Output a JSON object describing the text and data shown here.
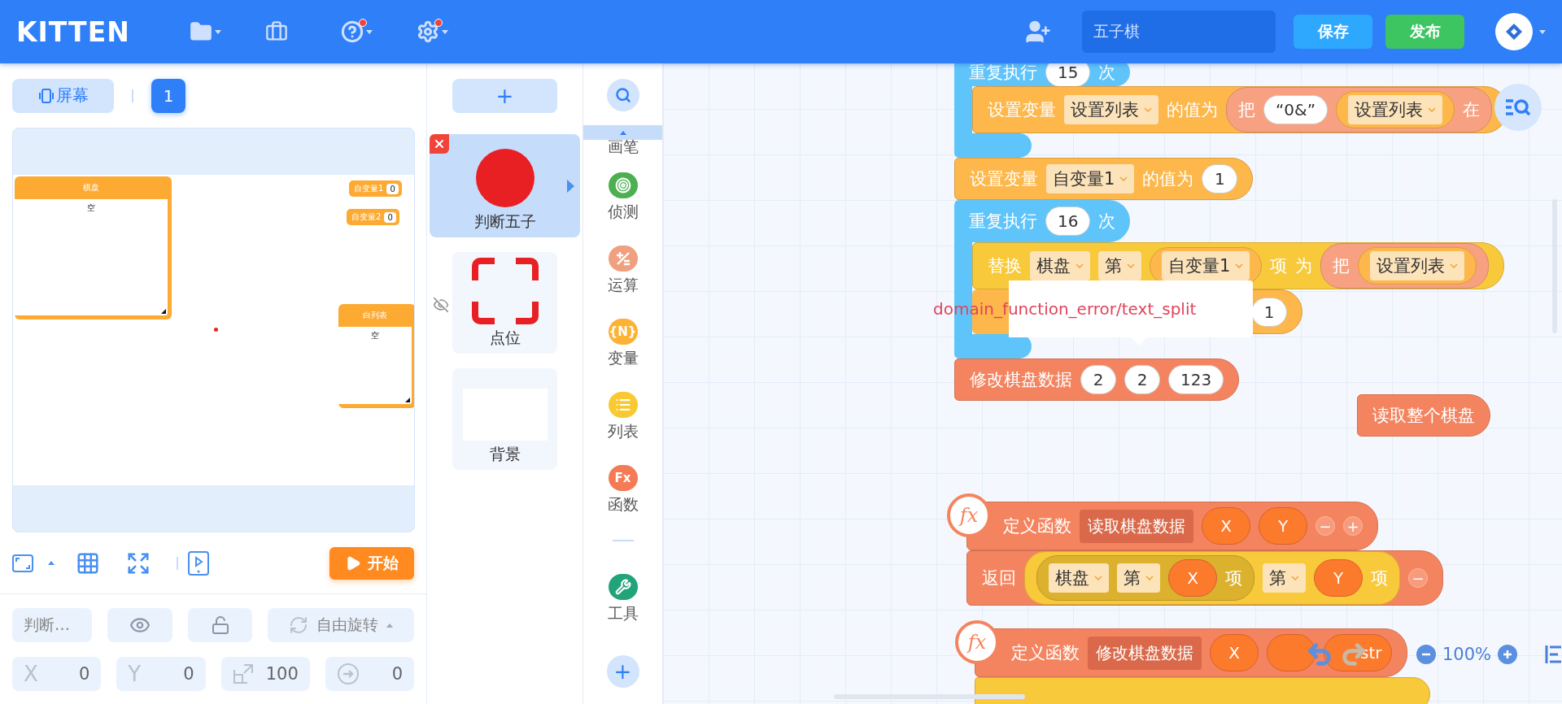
{
  "header": {
    "logo": "KITTEN",
    "menus": [
      {
        "kind": "file",
        "badge": false
      },
      {
        "kind": "bag",
        "badge": false
      },
      {
        "kind": "help",
        "badge": true
      },
      {
        "kind": "settings",
        "badge": true
      }
    ],
    "project_name": "五子棋",
    "save": "保存",
    "publish": "发布"
  },
  "stage_panel": {
    "screen_button": "屏幕",
    "screens": [
      {
        "label": "1",
        "selected": true
      }
    ],
    "monitors": [
      {
        "kind": "list",
        "title": "棋盘",
        "content": "空"
      },
      {
        "kind": "variable",
        "title": "自变量1",
        "value": "0"
      },
      {
        "kind": "variable",
        "title": "自变量2",
        "value": "0"
      },
      {
        "kind": "list",
        "title": "白列表",
        "content": "空"
      }
    ],
    "start": "开始",
    "sprite_props": {
      "name": "判断…",
      "rotation": "自由旋转",
      "fields": [
        {
          "kind": "x",
          "label": "X",
          "value": "0"
        },
        {
          "kind": "y",
          "label": "Y",
          "value": "0"
        },
        {
          "kind": "size",
          "value": "100"
        },
        {
          "kind": "direction",
          "value": "0"
        }
      ]
    }
  },
  "sprites": {
    "add": "+",
    "items": [
      {
        "name": "判断五子",
        "kind": "circle",
        "selected": true,
        "hidden": false
      },
      {
        "name": "点位",
        "kind": "corners",
        "selected": false,
        "hidden": true
      },
      {
        "name": "背景",
        "kind": "blank",
        "selected": false,
        "hidden": false
      }
    ]
  },
  "categories": {
    "items": [
      {
        "kind": "pen",
        "label": "画笔"
      },
      {
        "kind": "sensing",
        "label": "侦测",
        "color": "#4caf50"
      },
      {
        "kind": "operator",
        "label": "运算",
        "color": "#f0a07f"
      },
      {
        "kind": "variable",
        "label": "变量",
        "glyph": "{N}",
        "color": "#fdb235"
      },
      {
        "kind": "list",
        "label": "列表",
        "color": "#f9c932"
      },
      {
        "kind": "function",
        "label": "函数",
        "glyph": "Fx",
        "color": "#f47b55"
      },
      {
        "kind": "tool",
        "label": "工具",
        "color": "#22a37a"
      }
    ],
    "add": "+"
  },
  "canvas": {
    "scripts": [
      {
        "blocks": [
          {
            "kind": "loop",
            "color": "#5fc4fa",
            "parts": [
              {
                "kind": "label",
                "text": "重复执行"
              },
              {
                "kind": "input",
                "text": "15"
              },
              {
                "kind": "label",
                "text": "次"
              }
            ],
            "body": [
              {
                "kind": "command",
                "color": "#fdb74a",
                "parts": [
                  {
                    "kind": "label",
                    "text": "设置变量"
                  },
                  {
                    "kind": "dropdown",
                    "text": "设置列表"
                  },
                  {
                    "kind": "label",
                    "text": "的值为"
                  },
                  {
                    "kind": "reporter",
                    "color": "#f7a182",
                    "parts": [
                      {
                        "kind": "label",
                        "text": "把"
                      },
                      {
                        "kind": "input",
                        "text": "“0&”"
                      },
                      {
                        "kind": "reporter",
                        "color": "#fdb74a",
                        "parts": [
                          {
                            "kind": "dropdown",
                            "text": "设置列表"
                          }
                        ]
                      },
                      {
                        "kind": "label",
                        "text": "在"
                      }
                    ]
                  }
                ]
              }
            ]
          },
          {
            "kind": "command",
            "color": "#fdb74a",
            "parts": [
              {
                "kind": "label",
                "text": "设置变量"
              },
              {
                "kind": "dropdown",
                "text": "自变量1"
              },
              {
                "kind": "label",
                "text": "的值为"
              },
              {
                "kind": "input",
                "text": "1"
              }
            ]
          },
          {
            "kind": "loop",
            "color": "#5fc4fa",
            "parts": [
              {
                "kind": "label",
                "text": "重复执行"
              },
              {
                "kind": "input",
                "text": "16"
              },
              {
                "kind": "label",
                "text": "次"
              }
            ],
            "body": [
              {
                "kind": "command",
                "color": "#f8c93a",
                "parts": [
                  {
                    "kind": "label",
                    "text": "替换"
                  },
                  {
                    "kind": "dropdown",
                    "text": "棋盘"
                  },
                  {
                    "kind": "dropdown",
                    "text": "第"
                  },
                  {
                    "kind": "reporter",
                    "color": "#fdb74a",
                    "parts": [
                      {
                        "kind": "dropdown",
                        "text": "自变量1"
                      }
                    ]
                  },
                  {
                    "kind": "label",
                    "text": "项"
                  },
                  {
                    "kind": "label",
                    "text": "为"
                  },
                  {
                    "kind": "reporter",
                    "color": "#f7a182",
                    "parts": [
                      {
                        "kind": "label",
                        "text": "把"
                      },
                      {
                        "kind": "reporter",
                        "color": "#fdb74a",
                        "parts": [
                          {
                            "kind": "dropdown",
                            "text": "设置列表"
                          }
                        ]
                      }
                    ]
                  }
                ]
              },
              {
                "kind": "command",
                "color": "#fdb74a",
                "parts": [
                  {
                    "kind": "input",
                    "text": "1"
                  }
                ]
              }
            ]
          },
          {
            "kind": "command",
            "color": "#f4845f",
            "parts": [
              {
                "kind": "label",
                "text": "修改棋盘数据"
              },
              {
                "kind": "input",
                "text": "2"
              },
              {
                "kind": "input",
                "text": "2"
              },
              {
                "kind": "input",
                "text": "123"
              }
            ]
          }
        ]
      },
      {
        "blocks": [
          {
            "kind": "command",
            "color": "#f4845f",
            "parts": [
              {
                "kind": "label",
                "text": "读取整个棋盘"
              }
            ]
          }
        ]
      },
      {
        "blocks": [
          {
            "kind": "define",
            "color": "#f4845f",
            "badge": "fx",
            "parts": [
              {
                "kind": "label",
                "text": "定义函数"
              },
              {
                "kind": "name",
                "text": "读取棋盘数据"
              },
              {
                "kind": "param",
                "text": "X"
              },
              {
                "kind": "param",
                "text": "Y"
              },
              {
                "kind": "button",
                "text": "−"
              },
              {
                "kind": "button",
                "text": "+"
              }
            ]
          },
          {
            "kind": "command",
            "color": "#f4845f",
            "parts": [
              {
                "kind": "label",
                "text": "返回"
              },
              {
                "kind": "reporter",
                "color": "#f8c93a",
                "parts": [
                  {
                    "kind": "reporter",
                    "color": "#dcb12e",
                    "parts": [
                      {
                        "kind": "dropdown",
                        "text": "棋盘"
                      },
                      {
                        "kind": "dropdown",
                        "text": "第"
                      },
                      {
                        "kind": "param",
                        "text": "X"
                      },
                      {
                        "kind": "label",
                        "text": "项"
                      }
                    ]
                  },
                  {
                    "kind": "dropdown",
                    "text": "第"
                  },
                  {
                    "kind": "param",
                    "text": "Y"
                  },
                  {
                    "kind": "label",
                    "text": "项"
                  }
                ]
              },
              {
                "kind": "button",
                "text": "−"
              }
            ]
          }
        ]
      },
      {
        "blocks": [
          {
            "kind": "define",
            "color": "#f4845f",
            "badge": "fx",
            "parts": [
              {
                "kind": "label",
                "text": "定义函数"
              },
              {
                "kind": "name",
                "text": "修改棋盘数据"
              },
              {
                "kind": "param",
                "text": "X"
              },
              {
                "kind": "param"
              },
              {
                "kind": "param",
                "text": "str"
              }
            ]
          },
          {
            "kind": "command",
            "color": "#f8c93a"
          }
        ]
      }
    ],
    "error_tooltip": "domain_function_error/text_split",
    "zoom": {
      "reading": "100%",
      "redo_disabled": true
    }
  }
}
